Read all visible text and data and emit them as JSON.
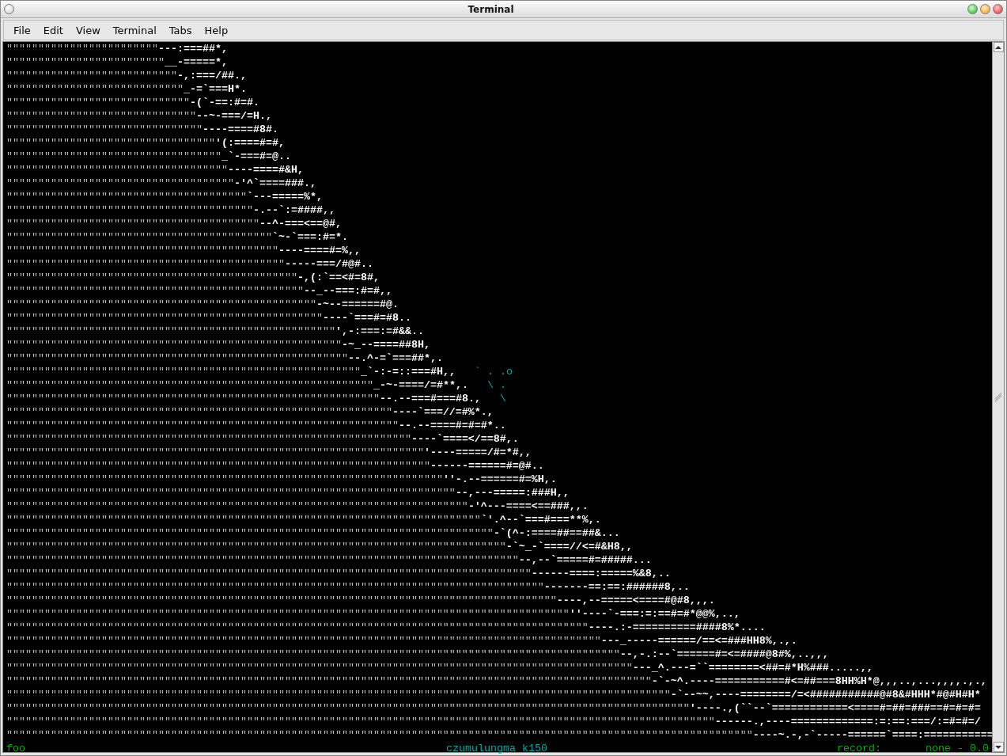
{
  "window": {
    "title": "Terminal"
  },
  "menu": [
    "File",
    "Edit",
    "View",
    "Terminal",
    "Tabs",
    "Help"
  ],
  "terminal": {
    "lines": [
      {
        "fill": "\"\"\"\"\"\"\"\"\"\"\"\"\"\"\"\"\"\"\"\"\"\"\"\"",
        "art": "---:===##*,"
      },
      {
        "fill": "\"\"\"\"\"\"\"\"\"\"\"\"\"\"\"\"\"\"\"\"\"\"\"\"\"",
        "art": "__-=====*,"
      },
      {
        "fill": "\"\"\"\"\"\"\"\"\"\"\"\"\"\"\"\"\"\"\"\"\"\"\"\"\"\"\"",
        "art": "-,:===/##.,"
      },
      {
        "fill": "\"\"\"\"\"\"\"\"\"\"\"\"\"\"\"\"\"\"\"\"\"\"\"\"\"\"\"\"",
        "art": "_-=`===H*."
      },
      {
        "fill": "\"\"\"\"\"\"\"\"\"\"\"\"\"\"\"\"\"\"\"\"\"\"\"\"\"\"\"\"\"",
        "art": "-(`-==:#=#."
      },
      {
        "fill": "\"\"\"\"\"\"\"\"\"\"\"\"\"\"\"\"\"\"\"\"\"\"\"\"\"\"\"\"\"\"",
        "art": "--~-===/=H.,"
      },
      {
        "fill": "\"\"\"\"\"\"\"\"\"\"\"\"\"\"\"\"\"\"\"\"\"\"\"\"\"\"\"\"\"\"\"",
        "art": "----====#8#."
      },
      {
        "fill": "\"\"\"\"\"\"\"\"\"\"\"\"\"\"\"\"\"\"\"\"\"\"\"\"\"\"\"\"\"\"\"\"\"",
        "art": "'(:====#=#,"
      },
      {
        "fill": "\"\"\"\"\"\"\"\"\"\"\"\"\"\"\"\"\"\"\"\"\"\"\"\"\"\"\"\"\"\"\"\"\"\"",
        "art": "_`-===#=@.."
      },
      {
        "fill": "\"\"\"\"\"\"\"\"\"\"\"\"\"\"\"\"\"\"\"\"\"\"\"\"\"\"\"\"\"\"\"\"\"\"\"",
        "art": "----====#&H,"
      },
      {
        "fill": "\"\"\"\"\"\"\"\"\"\"\"\"\"\"\"\"\"\"\"\"\"\"\"\"\"\"\"\"\"\"\"\"\"\"\"\"",
        "art": "-'^`====###.,"
      },
      {
        "fill": "\"\"\"\"\"\"\"\"\"\"\"\"\"\"\"\"\"\"\"\"\"\"\"\"\"\"\"\"\"\"\"\"\"\"\"\"\"\"",
        "art": "`---=====%*,"
      },
      {
        "fill": "\"\"\"\"\"\"\"\"\"\"\"\"\"\"\"\"\"\"\"\"\"\"\"\"\"\"\"\"\"\"\"\"\"\"\"\"\"\"\"",
        "art": "-.--`:=####,,"
      },
      {
        "fill": "\"\"\"\"\"\"\"\"\"\"\"\"\"\"\"\"\"\"\"\"\"\"\"\"\"\"\"\"\"\"\"\"\"\"\"\"\"\"\"\"",
        "art": "--^-===<==@#,"
      },
      {
        "fill": "\"\"\"\"\"\"\"\"\"\"\"\"\"\"\"\"\"\"\"\"\"\"\"\"\"\"\"\"\"\"\"\"\"\"\"\"\"\"\"\"\"\"",
        "art": "`~-`===:#=*."
      },
      {
        "fill": "\"\"\"\"\"\"\"\"\"\"\"\"\"\"\"\"\"\"\"\"\"\"\"\"\"\"\"\"\"\"\"\"\"\"\"\"\"\"\"\"\"\"\"",
        "art": "----====#=%,,"
      },
      {
        "fill": "\"\"\"\"\"\"\"\"\"\"\"\"\"\"\"\"\"\"\"\"\"\"\"\"\"\"\"\"\"\"\"\"\"\"\"\"\"\"\"\"\"\"\"\"",
        "art": "-----===/#@#.."
      },
      {
        "fill": "\"\"\"\"\"\"\"\"\"\"\"\"\"\"\"\"\"\"\"\"\"\"\"\"\"\"\"\"\"\"\"\"\"\"\"\"\"\"\"\"\"\"\"\"\"\"",
        "art": "-,(:`==<#=8#,"
      },
      {
        "fill": "\"\"\"\"\"\"\"\"\"\"\"\"\"\"\"\"\"\"\"\"\"\"\"\"\"\"\"\"\"\"\"\"\"\"\"\"\"\"\"\"\"\"\"\"\"\"\"",
        "art": "--_--===:#=#,,"
      },
      {
        "fill": "\"\"\"\"\"\"\"\"\"\"\"\"\"\"\"\"\"\"\"\"\"\"\"\"\"\"\"\"\"\"\"\"\"\"\"\"\"\"\"\"\"\"\"\"\"\"\"\"\"",
        "art": "-~--======#@."
      },
      {
        "fill": "\"\"\"\"\"\"\"\"\"\"\"\"\"\"\"\"\"\"\"\"\"\"\"\"\"\"\"\"\"\"\"\"\"\"\"\"\"\"\"\"\"\"\"\"\"\"\"\"\"\"",
        "art": "----`===#=#8.."
      },
      {
        "fill": "\"\"\"\"\"\"\"\"\"\"\"\"\"\"\"\"\"\"\"\"\"\"\"\"\"\"\"\"\"\"\"\"\"\"\"\"\"\"\"\"\"\"\"\"\"\"\"\"\"\"\"\"",
        "art": "',-:===:=#&&.."
      },
      {
        "fill": "\"\"\"\"\"\"\"\"\"\"\"\"\"\"\"\"\"\"\"\"\"\"\"\"\"\"\"\"\"\"\"\"\"\"\"\"\"\"\"\"\"\"\"\"\"\"\"\"\"\"\"\"\"",
        "art": "-~_--====##8H,"
      },
      {
        "fill": "\"\"\"\"\"\"\"\"\"\"\"\"\"\"\"\"\"\"\"\"\"\"\"\"\"\"\"\"\"\"\"\"\"\"\"\"\"\"\"\"\"\"\"\"\"\"\"\"\"\"\"\"\"\"",
        "art": "--.^-=`===##*,."
      },
      {
        "fill": "\"\"\"\"\"\"\"\"\"\"\"\"\"\"\"\"\"\"\"\"\"\"\"\"\"\"\"\"\"\"\"\"\"\"\"\"\"\"\"\"\"\"\"\"\"\"\"\"\"\"\"\"\"\"\"\"",
        "art": "_`-:-=::===#H,,",
        "extra": "` . .o"
      },
      {
        "fill": "\"\"\"\"\"\"\"\"\"\"\"\"\"\"\"\"\"\"\"\"\"\"\"\"\"\"\"\"\"\"\"\"\"\"\"\"\"\"\"\"\"\"\"\"\"\"\"\"\"\"\"\"\"\"\"\"\"\"",
        "art": "_-~-====/=#**,.",
        "extra": "\\ ."
      },
      {
        "fill": "\"\"\"\"\"\"\"\"\"\"\"\"\"\"\"\"\"\"\"\"\"\"\"\"\"\"\"\"\"\"\"\"\"\"\"\"\"\"\"\"\"\"\"\"\"\"\"\"\"\"\"\"\"\"\"\"\"\"\"",
        "art": "--.--===#===#8.,",
        "extra": "\\"
      },
      {
        "fill": "\"\"\"\"\"\"\"\"\"\"\"\"\"\"\"\"\"\"\"\"\"\"\"\"\"\"\"\"\"\"\"\"\"\"\"\"\"\"\"\"\"\"\"\"\"\"\"\"\"\"\"\"\"\"\"\"\"\"\"\"\"",
        "art": "----`===//=#%*.,"
      },
      {
        "fill": "\"\"\"\"\"\"\"\"\"\"\"\"\"\"\"\"\"\"\"\"\"\"\"\"\"\"\"\"\"\"\"\"\"\"\"\"\"\"\"\"\"\"\"\"\"\"\"\"\"\"\"\"\"\"\"\"\"\"\"\"\"\"",
        "art": "--.--====#=#=#*.."
      },
      {
        "fill": "\"\"\"\"\"\"\"\"\"\"\"\"\"\"\"\"\"\"\"\"\"\"\"\"\"\"\"\"\"\"\"\"\"\"\"\"\"\"\"\"\"\"\"\"\"\"\"\"\"\"\"\"\"\"\"\"\"\"\"\"\"\"\"\"",
        "art": "----`====</==8#,."
      },
      {
        "fill": "\"\"\"\"\"\"\"\"\"\"\"\"\"\"\"\"\"\"\"\"\"\"\"\"\"\"\"\"\"\"\"\"\"\"\"\"\"\"\"\"\"\"\"\"\"\"\"\"\"\"\"\"\"\"\"\"\"\"\"\"\"\"\"\"\"\"",
        "art": "'----=====/#=*#,,"
      },
      {
        "fill": "\"\"\"\"\"\"\"\"\"\"\"\"\"\"\"\"\"\"\"\"\"\"\"\"\"\"\"\"\"\"\"\"\"\"\"\"\"\"\"\"\"\"\"\"\"\"\"\"\"\"\"\"\"\"\"\"\"\"\"\"\"\"\"\"\"\"\"",
        "art": "------======#=@#.."
      },
      {
        "fill": "\"\"\"\"\"\"\"\"\"\"\"\"\"\"\"\"\"\"\"\"\"\"\"\"\"\"\"\"\"\"\"\"\"\"\"\"\"\"\"\"\"\"\"\"\"\"\"\"\"\"\"\"\"\"\"\"\"\"\"\"\"\"\"\"\"\"\"\"\"",
        "art": "''-.--======#=%H,."
      },
      {
        "fill": "\"\"\"\"\"\"\"\"\"\"\"\"\"\"\"\"\"\"\"\"\"\"\"\"\"\"\"\"\"\"\"\"\"\"\"\"\"\"\"\"\"\"\"\"\"\"\"\"\"\"\"\"\"\"\"\"\"\"\"\"\"\"\"\"\"\"\"\"\"\"\"",
        "art": "--,---=====:###H,,"
      },
      {
        "fill": "\"\"\"\"\"\"\"\"\"\"\"\"\"\"\"\"\"\"\"\"\"\"\"\"\"\"\"\"\"\"\"\"\"\"\"\"\"\"\"\"\"\"\"\"\"\"\"\"\"\"\"\"\"\"\"\"\"\"\"\"\"\"\"\"\"\"\"\"\"\"\"\"\"",
        "art": "-'^---====<==###,,."
      },
      {
        "fill": "\"\"\"\"\"\"\"\"\"\"\"\"\"\"\"\"\"\"\"\"\"\"\"\"\"\"\"\"\"\"\"\"\"\"\"\"\"\"\"\"\"\"\"\"\"\"\"\"\"\"\"\"\"\"\"\"\"\"\"\"\"\"\"\"\"\"\"\"\"\"\"\"\"\"\"",
        "art": "`'.^--`===#===**%,."
      },
      {
        "fill": "\"\"\"\"\"\"\"\"\"\"\"\"\"\"\"\"\"\"\"\"\"\"\"\"\"\"\"\"\"\"\"\"\"\"\"\"\"\"\"\"\"\"\"\"\"\"\"\"\"\"\"\"\"\"\"\"\"\"\"\"\"\"\"\"\"\"\"\"\"\"\"\"\"\"\"\"\"",
        "art": "-`(^-:====##==##&..."
      },
      {
        "fill": "\"\"\"\"\"\"\"\"\"\"\"\"\"\"\"\"\"\"\"\"\"\"\"\"\"\"\"\"\"\"\"\"\"\"\"\"\"\"\"\"\"\"\"\"\"\"\"\"\"\"\"\"\"\"\"\"\"\"\"\"\"\"\"\"\"\"\"\"\"\"\"\"\"\"\"\"\"\"\"",
        "art": "-`~_-`====//<=#&H8,,"
      },
      {
        "fill": "\"\"\"\"\"\"\"\"\"\"\"\"\"\"\"\"\"\"\"\"\"\"\"\"\"\"\"\"\"\"\"\"\"\"\"\"\"\"\"\"\"\"\"\"\"\"\"\"\"\"\"\"\"\"\"\"\"\"\"\"\"\"\"\"\"\"\"\"\"\"\"\"\"\"\"\"\"\"\"\"\"",
        "art": "--,--`=====#=#####..."
      },
      {
        "fill": "\"\"\"\"\"\"\"\"\"\"\"\"\"\"\"\"\"\"\"\"\"\"\"\"\"\"\"\"\"\"\"\"\"\"\"\"\"\"\"\"\"\"\"\"\"\"\"\"\"\"\"\"\"\"\"\"\"\"\"\"\"\"\"\"\"\"\"\"\"\"\"\"\"\"\"\"\"\"\"\"\"\"\"",
        "art": "------====:=====%&8,.."
      },
      {
        "fill": "\"\"\"\"\"\"\"\"\"\"\"\"\"\"\"\"\"\"\"\"\"\"\"\"\"\"\"\"\"\"\"\"\"\"\"\"\"\"\"\"\"\"\"\"\"\"\"\"\"\"\"\"\"\"\"\"\"\"\"\"\"\"\"\"\"\"\"\"\"\"\"\"\"\"\"\"\"\"\"\"\"\"\"\"\"",
        "art": "-------==:==:######8,.."
      },
      {
        "fill": "\"\"\"\"\"\"\"\"\"\"\"\"\"\"\"\"\"\"\"\"\"\"\"\"\"\"\"\"\"\"\"\"\"\"\"\"\"\"\"\"\"\"\"\"\"\"\"\"\"\"\"\"\"\"\"\"\"\"\"\"\"\"\"\"\"\"\"\"\"\"\"\"\"\"\"\"\"\"\"\"\"\"\"\"\"\"\"",
        "art": "----,--=====<====#@#8,,,."
      },
      {
        "fill": "\"\"\"\"\"\"\"\"\"\"\"\"\"\"\"\"\"\"\"\"\"\"\"\"\"\"\"\"\"\"\"\"\"\"\"\"\"\"\"\"\"\"\"\"\"\"\"\"\"\"\"\"\"\"\"\"\"\"\"\"\"\"\"\"\"\"\"\"\"\"\"\"\"\"\"\"\"\"\"\"\"\"\"\"\"\"\"\"\"",
        "art": "''----`-===:=:==#=#*@@%,..,"
      },
      {
        "fill": "\"\"\"\"\"\"\"\"\"\"\"\"\"\"\"\"\"\"\"\"\"\"\"\"\"\"\"\"\"\"\"\"\"\"\"\"\"\"\"\"\"\"\"\"\"\"\"\"\"\"\"\"\"\"\"\"\"\"\"\"\"\"\"\"\"\"\"\"\"\"\"\"\"\"\"\"\"\"\"\"\"\"\"\"\"\"\"\"\"\"\"\"",
        "art": "----.:-==========####8%*...."
      },
      {
        "fill": "\"\"\"\"\"\"\"\"\"\"\"\"\"\"\"\"\"\"\"\"\"\"\"\"\"\"\"\"\"\"\"\"\"\"\"\"\"\"\"\"\"\"\"\"\"\"\"\"\"\"\"\"\"\"\"\"\"\"\"\"\"\"\"\"\"\"\"\"\"\"\"\"\"\"\"\"\"\"\"\"\"\"\"\"\"\"\"\"\"\"\"\"\"\"",
        "art": "---_-----======/==<=###HH8%,.,."
      },
      {
        "fill": "\"\"\"\"\"\"\"\"\"\"\"\"\"\"\"\"\"\"\"\"\"\"\"\"\"\"\"\"\"\"\"\"\"\"\"\"\"\"\"\"\"\"\"\"\"\"\"\"\"\"\"\"\"\"\"\"\"\"\"\"\"\"\"\"\"\"\"\"\"\"\"\"\"\"\"\"\"\"\"\"\"\"\"\"\"\"\"\"\"\"\"\"\"\"\"\"\"",
        "art": "--,-.:--`======#=<=####@8#%,..,,,"
      },
      {
        "fill": "\"\"\"\"\"\"\"\"\"\"\"\"\"\"\"\"\"\"\"\"\"\"\"\"\"\"\"\"\"\"\"\"\"\"\"\"\"\"\"\"\"\"\"\"\"\"\"\"\"\"\"\"\"\"\"\"\"\"\"\"\"\"\"\"\"\"\"\"\"\"\"\"\"\"\"\"\"\"\"\"\"\"\"\"\"\"\"\"\"\"\"\"\"\"\"\"\"\"\"",
        "art": "---_^.---=``========<##=#*H%###.....,,"
      },
      {
        "fill": "\"\"\"\"\"\"\"\"\"\"\"\"\"\"\"\"\"\"\"\"\"\"\"\"\"\"\"\"\"\"\"\"\"\"\"\"\"\"\"\"\"\"\"\"\"\"\"\"\"\"\"\"\"\"\"\"\"\"\"\"\"\"\"\"\"\"\"\"\"\"\"\"\"\"\"\"\"\"\"\"\"\"\"\"\"\"\"\"\"\"\"\"\"\"\"\"\"\"\"\"\"\"",
        "art": "-`-~^.----===========#<=##===8HH%H*@,,,..,...,,,,.,.,"
      },
      {
        "fill": "\"\"\"\"\"\"\"\"\"\"\"\"\"\"\"\"\"\"\"\"\"\"\"\"\"\"\"\"\"\"\"\"\"\"\"\"\"\"\"\"\"\"\"\"\"\"\"\"\"\"\"\"\"\"\"\"\"\"\"\"\"\"\"\"\"\"\"\"\"\"\"\"\"\"\"\"\"\"\"\"\"\"\"\"\"\"\"\"\"\"\"\"\"\"\"\"\"\"\"\"\"\"\"\"\"",
        "art": "-`--~~,----========/=<###########@#8&#HHH*#@#H#H*"
      },
      {
        "fill": "\"\"\"\"\"\"\"\"\"\"\"\"\"\"\"\"\"\"\"\"\"\"\"\"\"\"\"\"\"\"\"\"\"\"\"\"\"\"\"\"\"\"\"\"\"\"\"\"\"\"\"\"\"\"\"\"\"\"\"\"\"\"\"\"\"\"\"\"\"\"\"\"\"\"\"\"\"\"\"\"\"\"\"\"\"\"\"\"\"\"\"\"\"\"\"\"\"\"\"\"\"\"\"\"\"\"\"\"",
        "art": "'----.,(``--`============<====#=##=###==#=#=#="
      },
      {
        "fill": "\"\"\"\"\"\"\"\"\"\"\"\"\"\"\"\"\"\"\"\"\"\"\"\"\"\"\"\"\"\"\"\"\"\"\"\"\"\"\"\"\"\"\"\"\"\"\"\"\"\"\"\"\"\"\"\"\"\"\"\"\"\"\"\"\"\"\"\"\"\"\"\"\"\"\"\"\"\"\"\"\"\"\"\"\"\"\"\"\"\"\"\"\"\"\"\"\"\"\"\"\"\"\"\"\"\"\"\"\"\"\"\"",
        "art": "------.,----=============:=:==:===/:=#=#=/"
      },
      {
        "fill": "\"\"\"\"\"\"\"\"\"\"\"\"\"\"\"\"\"\"\"\"\"\"\"\"\"\"\"\"\"\"\"\"\"\"\"\"\"\"\"\"\"\"\"\"\"\"\"\"\"\"\"\"\"\"\"\"\"\"\"\"\"\"\"\"\"\"\"\"\"\"\"\"\"\"\"\"\"\"\"\"\"\"\"\"\"\"\"\"\"\"\"\"\"\"\"\"\"\"\"\"\"\"\"\"\"\"\"\"\"\"\"\"\"\"\"\"\"\"",
        "art": "----~.-,-`-----======`====:==========="
      }
    ],
    "status": {
      "left": "foo",
      "center": "czumulungma k150",
      "label": "record:",
      "value": "none - 0.0"
    }
  }
}
